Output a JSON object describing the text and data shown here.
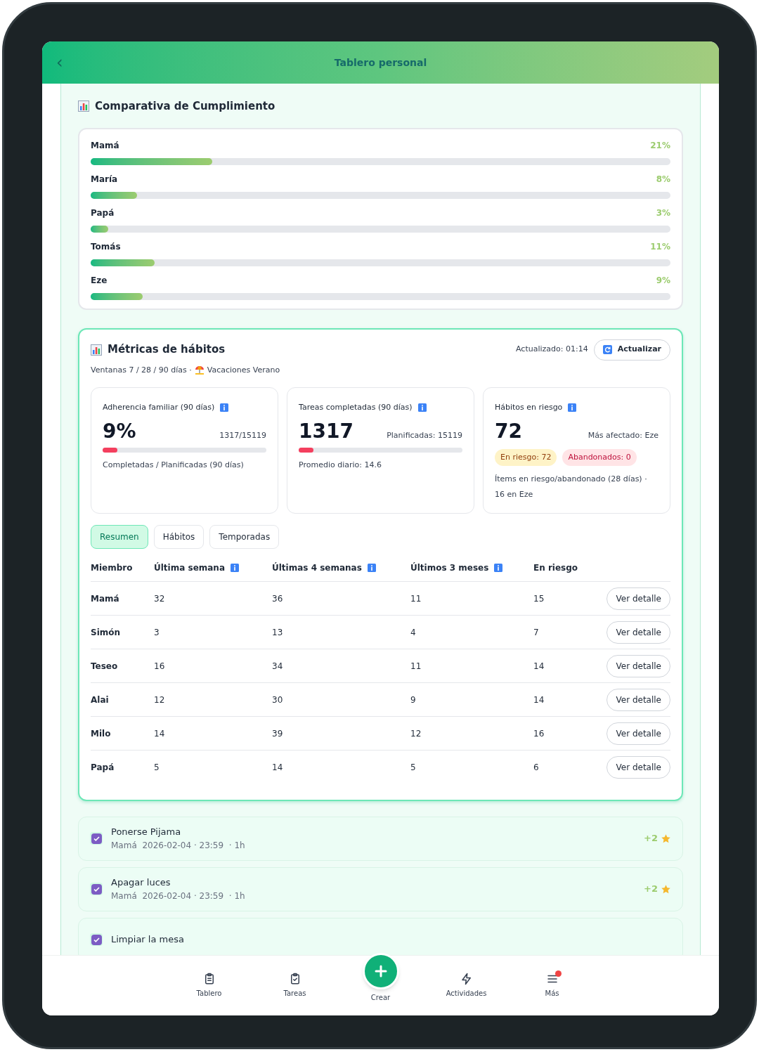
{
  "header": {
    "back": "‹",
    "title": "Tablero personal"
  },
  "compliance": {
    "title": "Comparativa de Cumplimiento",
    "members": [
      {
        "name": "Mamá",
        "percent": "21%",
        "level": 0.21
      },
      {
        "name": "María",
        "percent": "8%",
        "level": 0.08
      },
      {
        "name": "Papá",
        "percent": "3%",
        "level": 0.03
      },
      {
        "name": "Tomás",
        "percent": "11%",
        "level": 0.11
      },
      {
        "name": "Eze",
        "percent": "9%",
        "level": 0.09
      }
    ]
  },
  "metrics": {
    "title": "Métricas de hábitos",
    "updated": "Actualizado: 01:14",
    "refresh_button": "Actualizar",
    "subtitle": "Ventanas 7 / 28 / 90 días ·",
    "season": "Vacaciones Verano",
    "cards": [
      {
        "kind": "progress",
        "title": "Adherencia familiar (90 días)",
        "value": "9%",
        "side": "1317/15119",
        "level": 0.09,
        "note": "Completadas / Planificadas (90 días)"
      },
      {
        "kind": "progress",
        "title": "Tareas completadas (90 días)",
        "value": "1317",
        "side": "Planificadas: 15119",
        "level": 0.09,
        "note": "Promedio diario: 14.6"
      },
      {
        "kind": "risk",
        "title": "Hábitos en riesgo",
        "value": "72",
        "side": "Más afectado: Eze",
        "tags": [
          "En riesgo: 72",
          "Abandonados: 0"
        ],
        "note": "Ítems en riesgo/abandonado (28 días) · 16 en Eze"
      }
    ],
    "tabs": [
      {
        "label": "Resumen",
        "selected": true
      },
      {
        "label": "Hábitos",
        "selected": false
      },
      {
        "label": "Temporadas",
        "selected": false
      }
    ],
    "table": {
      "columns": [
        {
          "label": "Miembro",
          "info": false
        },
        {
          "label": "Última semana",
          "info": true
        },
        {
          "label": "Últimas 4 semanas",
          "info": true
        },
        {
          "label": "Últimos 3 meses",
          "info": true
        },
        {
          "label": "En riesgo",
          "info": false
        }
      ],
      "rows": [
        {
          "cells": [
            "Mamá",
            "32",
            "36",
            "11",
            "15"
          ],
          "action": "Ver detalle"
        },
        {
          "cells": [
            "Simón",
            "3",
            "13",
            "4",
            "7"
          ],
          "action": "Ver detalle"
        },
        {
          "cells": [
            "Teseo",
            "16",
            "34",
            "11",
            "14"
          ],
          "action": "Ver detalle"
        },
        {
          "cells": [
            "Alai",
            "12",
            "30",
            "9",
            "14"
          ],
          "action": "Ver detalle"
        },
        {
          "cells": [
            "Milo",
            "14",
            "39",
            "12",
            "16"
          ],
          "action": "Ver detalle"
        },
        {
          "cells": [
            "Papá",
            "5",
            "14",
            "5",
            "6"
          ],
          "action": "Ver detalle"
        }
      ]
    }
  },
  "tasks": [
    {
      "title": "Ponerse Pijama",
      "meta": "Mamá  2026-02-04 · 23:59  · 1h",
      "points": "+2",
      "checked": true
    },
    {
      "title": "Apagar luces",
      "meta": "Mamá  2026-02-04 · 23:59  · 1h",
      "points": "+2",
      "checked": true
    },
    {
      "title": "Limpiar la mesa",
      "checked": true
    }
  ],
  "nav": [
    {
      "kind": "board",
      "label": "Tablero",
      "badge": false
    },
    {
      "kind": "tasks",
      "label": "Tareas",
      "badge": false
    },
    {
      "kind": "create",
      "label": "Crear"
    },
    {
      "kind": "activity",
      "label": "Actividades",
      "badge": false
    },
    {
      "kind": "more",
      "label": "Más",
      "badge": true
    }
  ]
}
